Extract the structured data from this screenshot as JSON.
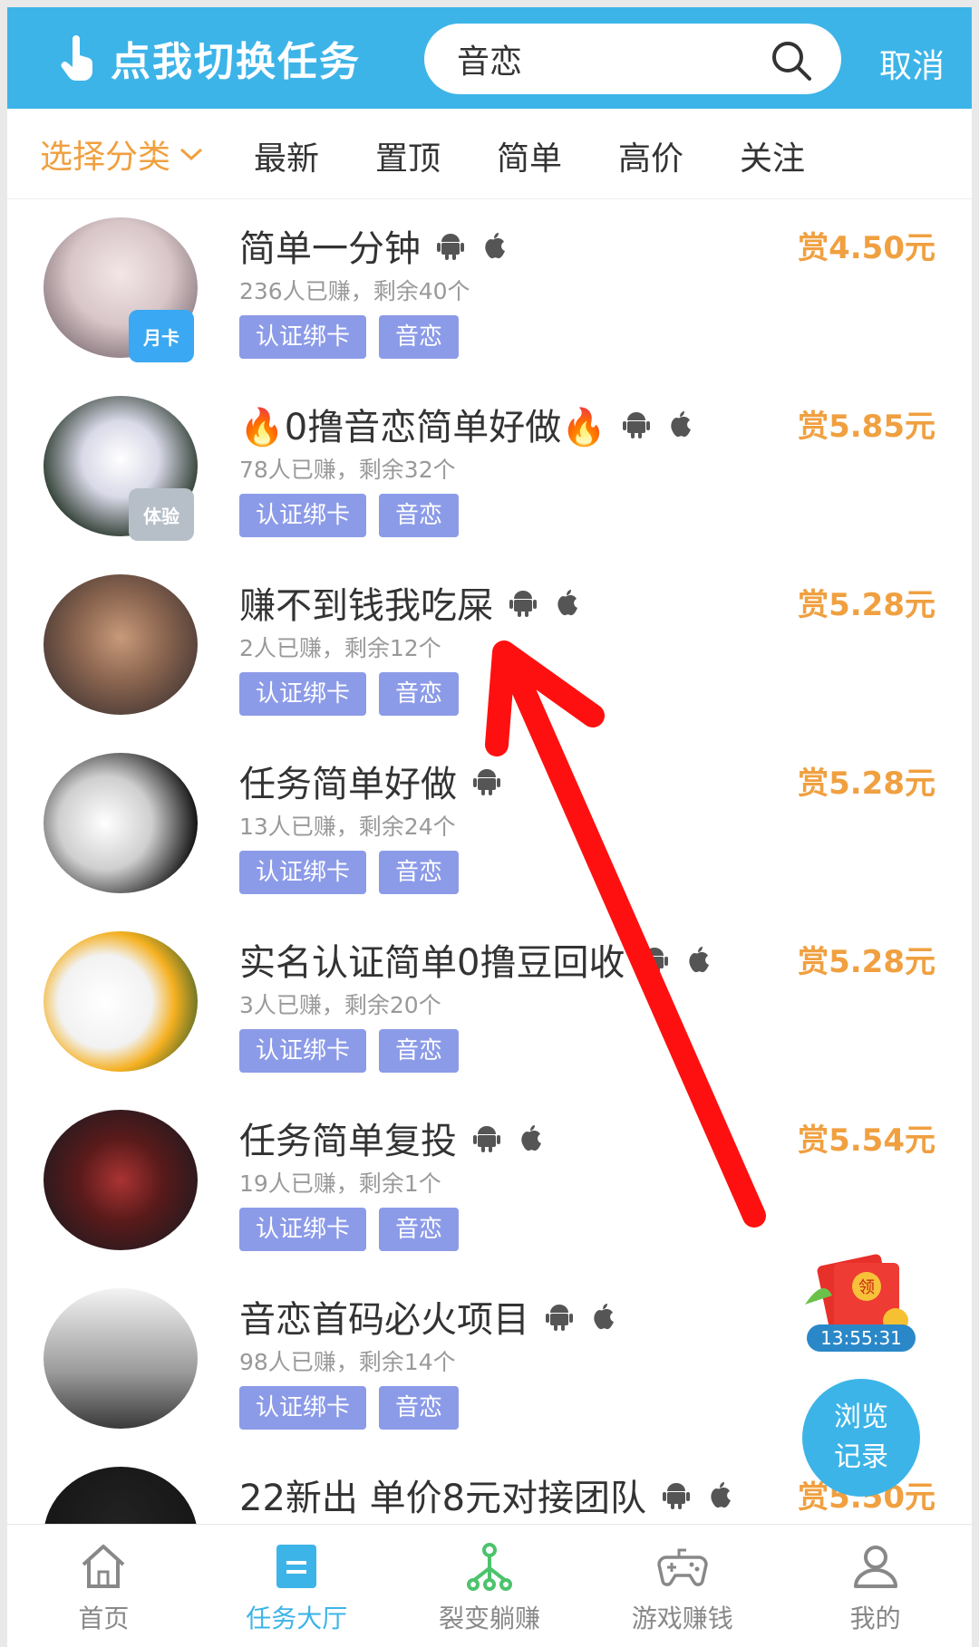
{
  "header": {
    "switch_label": "点我切换任务",
    "search_value": "音恋",
    "cancel_label": "取消"
  },
  "filters": {
    "category_label": "选择分类",
    "items": [
      "最新",
      "置顶",
      "简单",
      "高价",
      "关注"
    ]
  },
  "tasks": [
    {
      "title": "简单一分钟",
      "meta": "236人已赚，剩余40个",
      "reward": "赏4.50元",
      "tags": [
        "认证绑卡",
        "音恋"
      ],
      "badge": "月卡",
      "android": true,
      "ios": true
    },
    {
      "title": "🔥0撸音恋简单好做🔥",
      "meta": "78人已赚，剩余32个",
      "reward": "赏5.85元",
      "tags": [
        "认证绑卡",
        "音恋"
      ],
      "badge": "体验",
      "android": true,
      "ios": true
    },
    {
      "title": "赚不到钱我吃屎",
      "meta": "2人已赚，剩余12个",
      "reward": "赏5.28元",
      "tags": [
        "认证绑卡",
        "音恋"
      ],
      "badge": "",
      "android": true,
      "ios": true
    },
    {
      "title": "任务简单好做",
      "meta": "13人已赚，剩余24个",
      "reward": "赏5.28元",
      "tags": [
        "认证绑卡",
        "音恋"
      ],
      "badge": "",
      "android": true,
      "ios": false
    },
    {
      "title": "实名认证简单0撸豆回收",
      "meta": "3人已赚，剩余20个",
      "reward": "赏5.28元",
      "tags": [
        "认证绑卡",
        "音恋"
      ],
      "badge": "",
      "android": true,
      "ios": true
    },
    {
      "title": "任务简单复投",
      "meta": "19人已赚，剩余1个",
      "reward": "赏5.54元",
      "tags": [
        "认证绑卡",
        "音恋"
      ],
      "badge": "",
      "android": true,
      "ios": true
    },
    {
      "title": "音恋首码必火项目",
      "meta": "98人已赚，剩余14个",
      "reward": "",
      "tags": [
        "认证绑卡",
        "音恋"
      ],
      "badge": "",
      "android": true,
      "ios": true
    },
    {
      "title": "22新出 单价8元对接团队",
      "meta": "",
      "reward": "赏5.50元",
      "tags": [],
      "badge": "",
      "android": true,
      "ios": true
    }
  ],
  "floating": {
    "redpack_label": "领",
    "timer": "13:55:31",
    "history_line1": "浏览",
    "history_line2": "记录"
  },
  "bottom_nav": [
    {
      "label": "首页",
      "icon": "home-icon"
    },
    {
      "label": "任务大厅",
      "icon": "task-hall-icon"
    },
    {
      "label": "裂变躺赚",
      "icon": "referral-icon"
    },
    {
      "label": "游戏赚钱",
      "icon": "gamepad-icon"
    },
    {
      "label": "我的",
      "icon": "user-icon"
    }
  ],
  "colors": {
    "primary": "#3db4e8",
    "reward": "#f0a040",
    "tag": "#8c9be8",
    "annotation": "#ff1010"
  }
}
